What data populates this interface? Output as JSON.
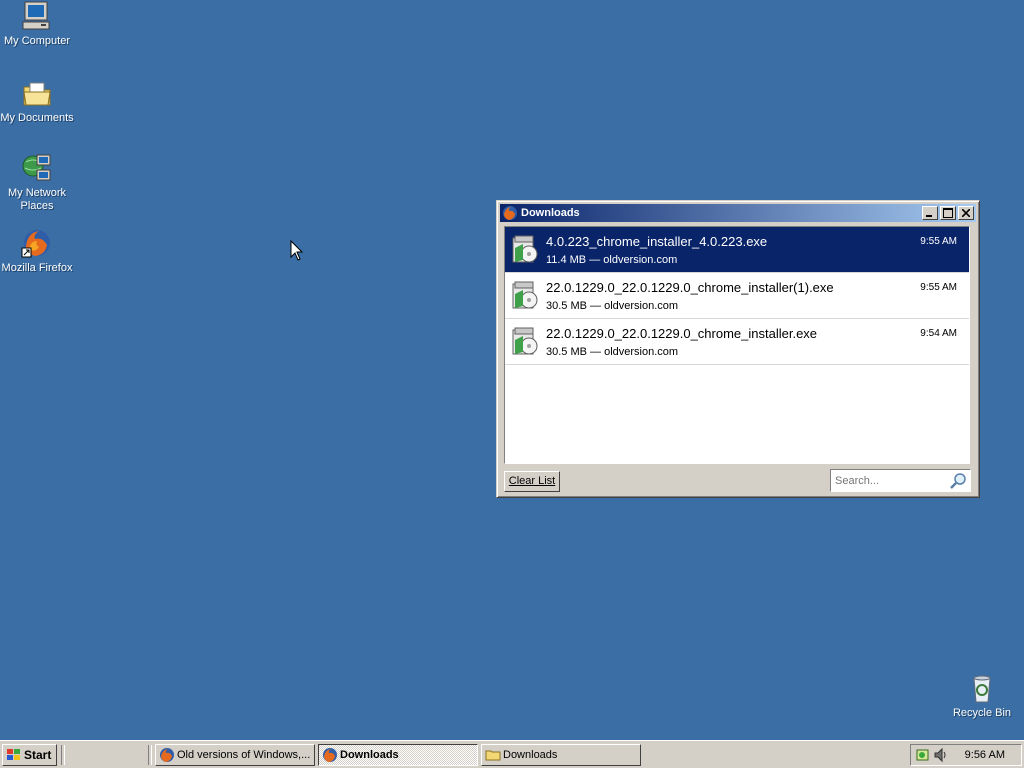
{
  "desktop": {
    "icons": [
      {
        "label": "My Computer",
        "icon": "my-computer-icon"
      },
      {
        "label": "My Documents",
        "icon": "folder-documents-icon"
      },
      {
        "label": "My Network Places",
        "icon": "network-places-icon"
      },
      {
        "label": "Mozilla Firefox",
        "icon": "firefox-icon"
      },
      {
        "label": "Recycle Bin",
        "icon": "recycle-bin-icon"
      }
    ],
    "background_color": "#3a6ea5"
  },
  "downloads_window": {
    "title": "Downloads",
    "title_icon": "firefox-icon",
    "controls": {
      "minimize": "minimize-icon",
      "maximize": "maximize-icon",
      "close": "close-icon"
    },
    "items": [
      {
        "filename": "4.0.223_chrome_installer_4.0.223.exe",
        "meta": "11.4 MB — oldversion.com",
        "time": "9:55 AM",
        "selected": true
      },
      {
        "filename": "22.0.1229.0_22.0.1229.0_chrome_installer(1).exe",
        "meta": "30.5 MB — oldversion.com",
        "time": "9:55 AM",
        "selected": false
      },
      {
        "filename": "22.0.1229.0_22.0.1229.0_chrome_installer.exe",
        "meta": "30.5 MB — oldversion.com",
        "time": "9:54 AM",
        "selected": false
      }
    ],
    "clear_list_label": "Clear List",
    "search_placeholder": "Search..."
  },
  "taskbar": {
    "start_label": "Start",
    "tasks": [
      {
        "label": "Old versions of Windows,...",
        "icon": "firefox-icon",
        "active": false
      },
      {
        "label": "Downloads",
        "icon": "firefox-icon",
        "active": true
      },
      {
        "label": "Downloads",
        "icon": "folder-icon",
        "active": false
      }
    ],
    "clock": "9:56 AM"
  },
  "colors": {
    "selection": "#0a246a",
    "title_gradient_start": "#0a246a",
    "title_gradient_end": "#a6caf0",
    "window_face": "#d4d0c8"
  }
}
